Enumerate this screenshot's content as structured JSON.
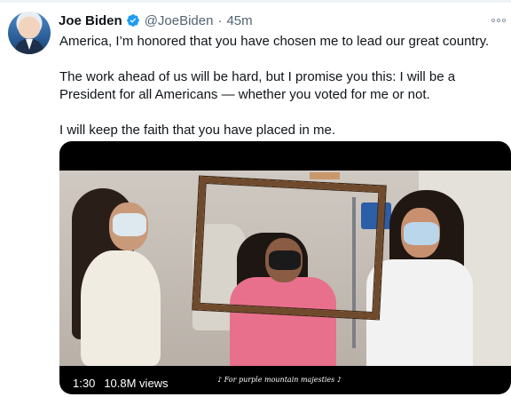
{
  "tweet": {
    "author_name": "Joe Biden",
    "handle": "@JoeBiden",
    "separator": "·",
    "time": "45m",
    "verified": true,
    "paragraphs": [
      "America, I’m honored that you have chosen me to lead our great country.",
      "The work ahead of us will be hard, but I promise you this: I will be a President for all Americans — whether you voted for me or not.",
      "I will keep the faith that you have placed in me."
    ]
  },
  "media": {
    "type": "video",
    "duration": "1:30",
    "views": "10.8M views",
    "caption": "♪ For purple mountain majesties ♪"
  },
  "icons": {
    "more": "more-horizontal-icon",
    "verified": "verified-badge-icon"
  },
  "colors": {
    "text": "#0f1419",
    "secondary": "#536471",
    "verified": "#1d9bf0"
  }
}
